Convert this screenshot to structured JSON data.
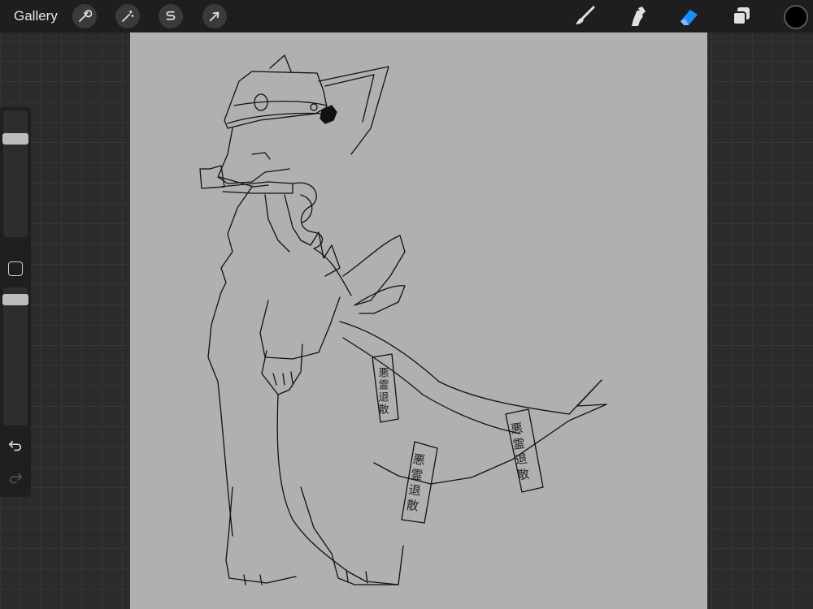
{
  "topbar": {
    "gallery_label": "Gallery",
    "actions_icon": "wrench-icon",
    "adjustments_icon": "magic-wand-icon",
    "selection_icon": "selection-s-icon",
    "transform_icon": "arrow-cursor-icon",
    "brush_icon": "paintbrush-icon",
    "smudge_icon": "smudge-finger-icon",
    "eraser_icon": "eraser-icon",
    "layers_icon": "layers-icon",
    "active_tool": "eraser",
    "active_color": "#000000",
    "accent_color": "#1a8cff"
  },
  "sidebar": {
    "brush_size_level": 0.8,
    "opacity_level": 0.95,
    "undo_icon": "undo-icon",
    "redo_icon": "redo-icon"
  },
  "canvas": {
    "background_color": "#b0b0b0",
    "talismans": [
      {
        "text": "悪霊退散"
      },
      {
        "text": "悪霊退散"
      },
      {
        "text": "悪霊退散"
      }
    ]
  }
}
